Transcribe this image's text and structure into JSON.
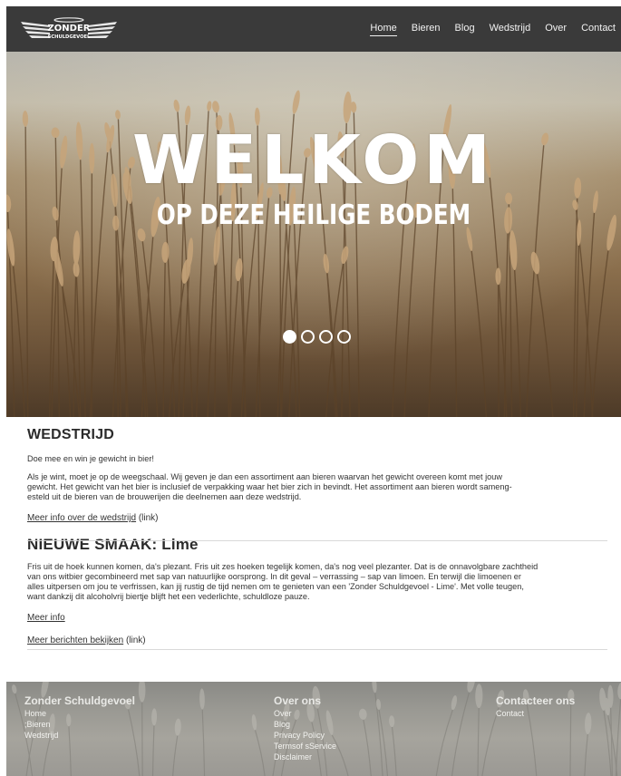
{
  "header": {
    "logo_text_top": "ZONDER",
    "logo_text_bottom": "SCHULDGEVOEL",
    "nav": [
      {
        "label": "Home",
        "active": true
      },
      {
        "label": "Bieren",
        "active": false
      },
      {
        "label": "Blog",
        "active": false
      },
      {
        "label": "Wedstrijd",
        "active": false
      },
      {
        "label": "Over",
        "active": false
      },
      {
        "label": "Contact",
        "active": false
      }
    ]
  },
  "hero": {
    "title": "WELKOM",
    "subtitle": "OP DEZE HEILIGE BODEM",
    "slides_total": 4,
    "active_slide": 1
  },
  "wedstrijd": {
    "heading": "WEDSTRIJD",
    "intro": "Doe mee en win je gewicht in bier!",
    "body_lines": [
      "Als je wint, moet je op de weegschaal. Wij geven je dan een assortiment aan bieren waarvan het gewicht overeen komt met jouw",
      "gewicht. Het gewicht van het bier is inclusief de verpakking waar het bier zich in bevindt. Het assortiment aan bieren wordt sameng-",
      "esteld uit de bieren van de brouwerijen die deelnemen aan deze wedstrijd."
    ],
    "link_text": "Meer info over de wedstrijd",
    "link_suffix": " (link)"
  },
  "nieuwe_smaak": {
    "heading": "NIEUWE SMAAK: Lime",
    "body_lines": [
      "Fris uit de hoek kunnen komen, da's plezant. Fris uit zes hoeken tegelijk komen, da's nog veel plezanter. Dat is de onnavolgbare zachtheid",
      "van ons witbier gecombineerd met sap van natuurlijke oorsprong. In dit geval – verrassing – sap van limoen. En terwijl die limoenen er",
      "alles uitpersen om jou te verfrissen, kan jij rustig de tijd nemen om te genieten van een 'Zonder Schuldgevoel - Lime'. Met volle teugen,",
      "want dankzij dit alcoholvrij biertje blijft het een vederlichte, schuldloze pauze."
    ],
    "link_text": "Meer info"
  },
  "berichten": {
    "link_text": "Meer berichten bekijken",
    "link_suffix": " (link)"
  },
  "footer": {
    "col1": {
      "heading": "Zonder Schuldgevoel",
      "items": [
        "Home",
        ";Bieren",
        "Wedstrijd"
      ]
    },
    "col2": {
      "heading": "Over ons",
      "items": [
        "Over",
        "Blog",
        "Privacy Policy",
        "Termsof sService",
        "Disclaimer"
      ]
    },
    "col3": {
      "heading": "Contacteer ons",
      "items": [
        "Contact"
      ]
    }
  },
  "colors": {
    "nav_bg": "#3a3a3a",
    "text": "#2b2b2b",
    "rule": "#d9d9d9"
  }
}
